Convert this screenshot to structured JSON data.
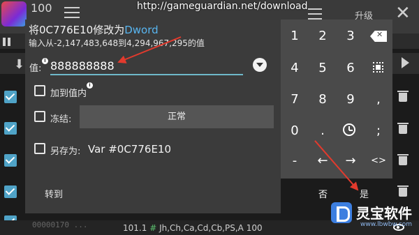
{
  "url_overlay": "http://gameguardian.net/download",
  "background": {
    "count": "100",
    "upgrade_label": "升级",
    "close_glyph": "✕",
    "status": {
      "value": "101.1",
      "hash": "#",
      "types": "Jh,Ch,Ca,Cd,Cb,PS,A 100"
    },
    "faded_row": "00000170    ..."
  },
  "dialog": {
    "title_prefix": "将0C776E10修改为",
    "title_type": "Dword",
    "range_hint": "输入从-2,147,483,648到4,294,967,295的值",
    "value_label": "值:",
    "value": "888888888",
    "add_to_value_label": "加到值内",
    "freeze_label": "冻结:",
    "freeze_mode": "正常",
    "save_as_label": "另存为:",
    "var_name": "Var #0C776E10",
    "goto_label": "转到",
    "no_label": "否",
    "yes_label": "是"
  },
  "keypad": {
    "rows": [
      [
        "1",
        "2",
        "3",
        "backspace"
      ],
      [
        "4",
        "5",
        "6",
        "select-all"
      ],
      [
        "7",
        "8",
        "9",
        ","
      ],
      [
        "0",
        ".",
        "history",
        ";"
      ],
      [
        "-",
        "←",
        "→",
        "<>"
      ]
    ]
  },
  "watermark": {
    "name": "灵宝软件",
    "url": "www.lbwbw.com"
  }
}
